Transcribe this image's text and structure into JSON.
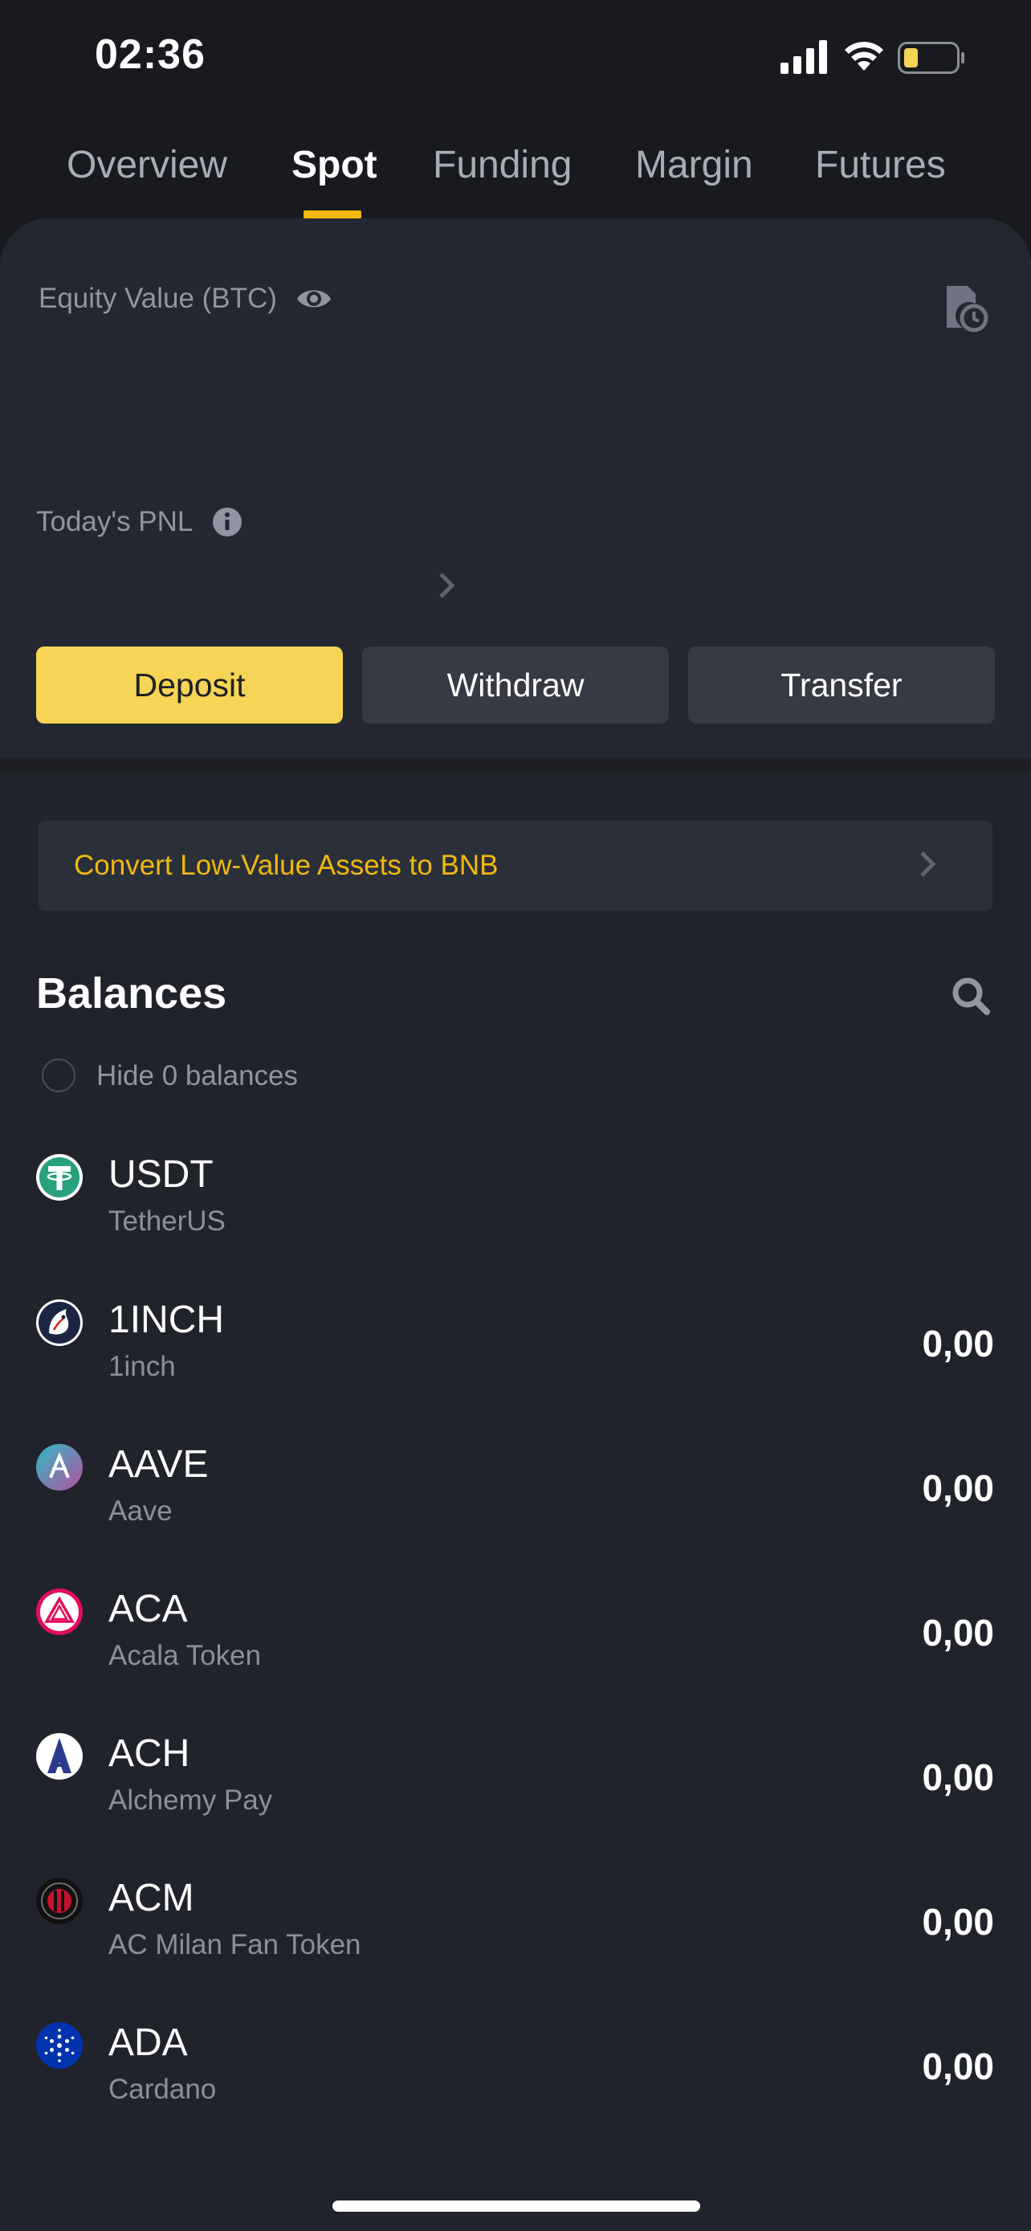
{
  "status_bar": {
    "time": "02:36",
    "battery_color": "#f5d456"
  },
  "tabs": [
    {
      "label": "Overview",
      "active": false
    },
    {
      "label": "Spot",
      "active": true
    },
    {
      "label": "Funding",
      "active": false
    },
    {
      "label": "Margin",
      "active": false
    },
    {
      "label": "Futures",
      "active": false
    }
  ],
  "summary": {
    "equity_label": "Equity Value (BTC)",
    "pnl_label": "Today's PNL"
  },
  "actions": {
    "deposit": "Deposit",
    "withdraw": "Withdraw",
    "transfer": "Transfer"
  },
  "convert_banner": {
    "text": "Convert Low-Value Assets to BNB"
  },
  "balances": {
    "title": "Balances",
    "hide_zero_label": "Hide 0 balances",
    "hide_zero_checked": false,
    "assets": [
      {
        "symbol": "USDT",
        "name": "TetherUS",
        "amount": "",
        "icon": "usdt-icon"
      },
      {
        "symbol": "1INCH",
        "name": "1inch",
        "amount": "0,00",
        "icon": "1inch-icon"
      },
      {
        "symbol": "AAVE",
        "name": "Aave",
        "amount": "0,00",
        "icon": "aave-icon"
      },
      {
        "symbol": "ACA",
        "name": "Acala Token",
        "amount": "0,00",
        "icon": "aca-icon"
      },
      {
        "symbol": "ACH",
        "name": "Alchemy Pay",
        "amount": "0,00",
        "icon": "ach-icon"
      },
      {
        "symbol": "ACM",
        "name": "AC Milan Fan Token",
        "amount": "0,00",
        "icon": "acm-icon"
      },
      {
        "symbol": "ADA",
        "name": "Cardano",
        "amount": "0,00",
        "icon": "ada-icon"
      }
    ]
  },
  "colors": {
    "accent": "#f0b90b",
    "background": "#181a20",
    "panel": "#242731"
  }
}
